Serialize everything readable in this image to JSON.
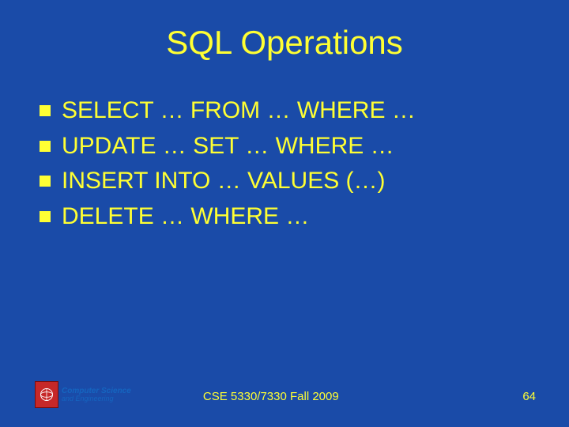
{
  "title": "SQL Operations",
  "bullets": [
    "SELECT … FROM … WHERE …",
    "UPDATE … SET … WHERE …",
    "INSERT INTO … VALUES (…)",
    "DELETE … WHERE …"
  ],
  "logo": {
    "line1": "Computer Science",
    "line2": "and Engineering"
  },
  "footer_text": "CSE 5330/7330 Fall 2009",
  "page_number": "64"
}
